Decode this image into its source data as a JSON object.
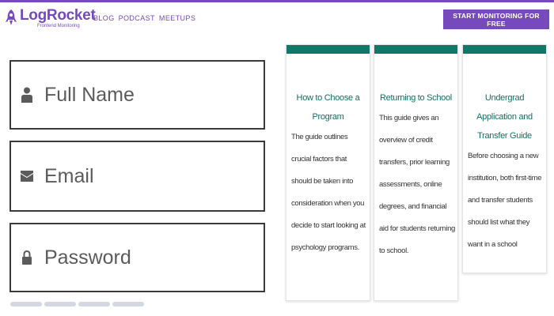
{
  "brand": {
    "name": "LogRocket",
    "tagline": "Frontend Monitoring",
    "color": "#764abc"
  },
  "nav": {
    "links": [
      "BLOG",
      "PODCAST",
      "MEETUPS"
    ],
    "cta_label": "START MONITORING FOR FREE"
  },
  "form": {
    "full_name": {
      "placeholder": "Full Name",
      "icon": "user-icon"
    },
    "email": {
      "placeholder": "Email",
      "icon": "envelope-icon"
    },
    "password": {
      "placeholder": "Password",
      "icon": "lock-icon"
    }
  },
  "pagination": {
    "count": 4
  },
  "cards": [
    {
      "title": "How to Choose a Program",
      "body": "The guide outlines crucial factors that should be taken into consideration when you decide to start looking at psychology programs."
    },
    {
      "title": "Returning to School",
      "body": "This guide gives an overview of credit transfers, prior learning assessments, online degrees, and financial aid for students returning to school."
    },
    {
      "title": "Undergrad Application and Transfer Guide",
      "body": "Before choosing a new institution, both first-time and transfer students should list what they want in a school"
    }
  ],
  "colors": {
    "card_accent": "#107868",
    "card_title": "#136f63",
    "input_border": "#3a3a3a"
  }
}
